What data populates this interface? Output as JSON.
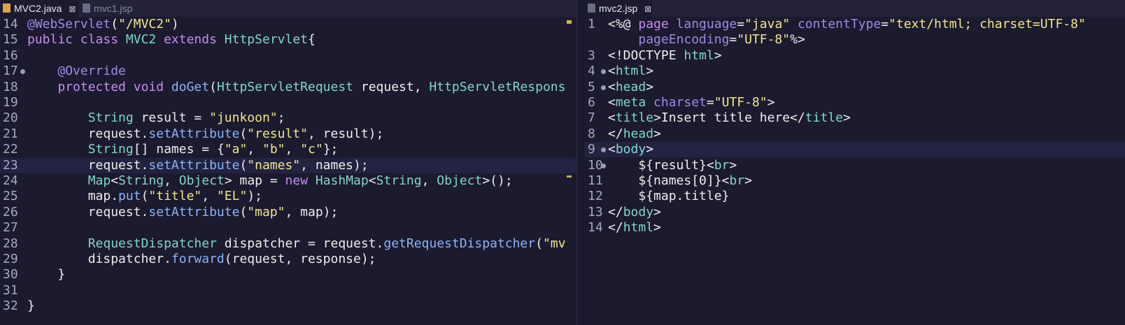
{
  "left_editor": {
    "tabs": [
      {
        "label": "MVC2.java",
        "active": true,
        "close": "⊠"
      },
      {
        "label": "mvc1.jsp",
        "active": false
      }
    ],
    "lines": [
      {
        "n": "14",
        "segs": [
          [
            "a",
            "@WebServlet"
          ],
          [
            "m",
            "("
          ],
          [
            "s",
            "\"/MVC2\""
          ],
          [
            "m",
            ")"
          ]
        ]
      },
      {
        "n": "15",
        "segs": [
          [
            "k",
            "public class "
          ],
          [
            "t",
            "MVC2"
          ],
          [
            "k",
            " extends "
          ],
          [
            "t",
            "HttpServlet"
          ],
          [
            "m",
            "{"
          ]
        ]
      },
      {
        "n": "16",
        "segs": []
      },
      {
        "n": "17",
        "segs": [
          [
            "m",
            "    "
          ],
          [
            "a",
            "@Override"
          ]
        ],
        "marker": true
      },
      {
        "n": "18",
        "segs": [
          [
            "m",
            "    "
          ],
          [
            "k",
            "protected void "
          ],
          [
            "f",
            "doGet"
          ],
          [
            "m",
            "("
          ],
          [
            "t",
            "HttpServletRequest"
          ],
          [
            "m",
            " request, "
          ],
          [
            "t",
            "HttpServletRespons"
          ]
        ]
      },
      {
        "n": "19",
        "segs": []
      },
      {
        "n": "20",
        "segs": [
          [
            "m",
            "        "
          ],
          [
            "t",
            "String"
          ],
          [
            "m",
            " result = "
          ],
          [
            "s",
            "\"junkoon\""
          ],
          [
            "m",
            ";"
          ]
        ]
      },
      {
        "n": "21",
        "segs": [
          [
            "m",
            "        request."
          ],
          [
            "f",
            "setAttribute"
          ],
          [
            "m",
            "("
          ],
          [
            "s",
            "\"result\""
          ],
          [
            "m",
            ", result);"
          ]
        ]
      },
      {
        "n": "22",
        "segs": [
          [
            "m",
            "        "
          ],
          [
            "t",
            "String"
          ],
          [
            "m",
            "[] names = {"
          ],
          [
            "s",
            "\"a\""
          ],
          [
            "m",
            ", "
          ],
          [
            "s",
            "\"b\""
          ],
          [
            "m",
            ", "
          ],
          [
            "s",
            "\"c\""
          ],
          [
            "m",
            "};"
          ]
        ]
      },
      {
        "n": "23",
        "segs": [
          [
            "m",
            "        request."
          ],
          [
            "f",
            "setAttribute"
          ],
          [
            "m",
            "("
          ],
          [
            "s",
            "\"names\""
          ],
          [
            "m",
            ", names);"
          ]
        ],
        "current": true
      },
      {
        "n": "24",
        "segs": [
          [
            "m",
            "        "
          ],
          [
            "t",
            "Map"
          ],
          [
            "m",
            "<"
          ],
          [
            "t",
            "String"
          ],
          [
            "m",
            ", "
          ],
          [
            "t",
            "Object"
          ],
          [
            "m",
            "> map = "
          ],
          [
            "k",
            "new "
          ],
          [
            "t",
            "HashMap"
          ],
          [
            "m",
            "<"
          ],
          [
            "t",
            "String"
          ],
          [
            "m",
            ", "
          ],
          [
            "t",
            "Object"
          ],
          [
            "m",
            ">();"
          ]
        ]
      },
      {
        "n": "25",
        "segs": [
          [
            "m",
            "        map."
          ],
          [
            "f",
            "put"
          ],
          [
            "m",
            "("
          ],
          [
            "s",
            "\"title\""
          ],
          [
            "m",
            ", "
          ],
          [
            "s",
            "\"EL\""
          ],
          [
            "m",
            ");"
          ]
        ]
      },
      {
        "n": "26",
        "segs": [
          [
            "m",
            "        request."
          ],
          [
            "f",
            "setAttribute"
          ],
          [
            "m",
            "("
          ],
          [
            "s",
            "\"map\""
          ],
          [
            "m",
            ", map);"
          ]
        ]
      },
      {
        "n": "27",
        "segs": []
      },
      {
        "n": "28",
        "segs": [
          [
            "m",
            "        "
          ],
          [
            "t",
            "RequestDispatcher"
          ],
          [
            "m",
            " dispatcher = request."
          ],
          [
            "f",
            "getRequestDispatcher"
          ],
          [
            "m",
            "("
          ],
          [
            "s",
            "\"mv"
          ]
        ]
      },
      {
        "n": "29",
        "segs": [
          [
            "m",
            "        dispatcher."
          ],
          [
            "f",
            "forward"
          ],
          [
            "m",
            "(request, response);"
          ]
        ]
      },
      {
        "n": "30",
        "segs": [
          [
            "m",
            "    }"
          ]
        ]
      },
      {
        "n": "31",
        "segs": []
      },
      {
        "n": "32",
        "segs": [
          [
            "m",
            "}"
          ]
        ]
      }
    ]
  },
  "right_editor": {
    "tabs": [
      {
        "label": "mvc2.jsp",
        "active": true,
        "close": "⊠"
      }
    ],
    "lines": [
      {
        "n": "1",
        "segs": [
          [
            "m",
            "<%@ "
          ],
          [
            "k",
            "page "
          ],
          [
            "attr",
            "language"
          ],
          [
            "m",
            "="
          ],
          [
            "s",
            "\"java\""
          ],
          [
            "m",
            " "
          ],
          [
            "attr",
            "contentType"
          ],
          [
            "m",
            "="
          ],
          [
            "s",
            "\"text/html; charset=UTF-8\""
          ]
        ]
      },
      {
        "n": "",
        "segs": [
          [
            "m",
            "    "
          ],
          [
            "attr",
            "pageEncoding"
          ],
          [
            "m",
            "="
          ],
          [
            "s",
            "\"UTF-8\""
          ],
          [
            "m",
            "%>"
          ]
        ]
      },
      {
        "n": "3",
        "segs": [
          [
            "m",
            "<!DOCTYPE "
          ],
          [
            "tag",
            "html"
          ],
          [
            "m",
            ">"
          ]
        ]
      },
      {
        "n": "4",
        "segs": [
          [
            "m",
            "<"
          ],
          [
            "tag",
            "html"
          ],
          [
            "m",
            ">"
          ]
        ],
        "marker": true
      },
      {
        "n": "5",
        "segs": [
          [
            "m",
            "<"
          ],
          [
            "tag",
            "head"
          ],
          [
            "m",
            ">"
          ]
        ],
        "marker": true
      },
      {
        "n": "6",
        "segs": [
          [
            "m",
            "<"
          ],
          [
            "tag",
            "meta "
          ],
          [
            "attr",
            "charset"
          ],
          [
            "m",
            "="
          ],
          [
            "s",
            "\"UTF-8\""
          ],
          [
            "m",
            ">"
          ]
        ]
      },
      {
        "n": "7",
        "segs": [
          [
            "m",
            "<"
          ],
          [
            "tag",
            "title"
          ],
          [
            "m",
            ">Insert title here</"
          ],
          [
            "tag",
            "title"
          ],
          [
            "m",
            ">"
          ]
        ]
      },
      {
        "n": "8",
        "segs": [
          [
            "m",
            "</"
          ],
          [
            "tag",
            "head"
          ],
          [
            "m",
            ">"
          ]
        ]
      },
      {
        "n": "9",
        "segs": [
          [
            "m",
            "<"
          ],
          [
            "tag",
            "body"
          ],
          [
            "m",
            ">"
          ]
        ],
        "marker": true,
        "current": true
      },
      {
        "n": "10",
        "segs": [
          [
            "m",
            "    ${result}<"
          ],
          [
            "tag",
            "br"
          ],
          [
            "m",
            ">"
          ]
        ],
        "marker": true
      },
      {
        "n": "11",
        "segs": [
          [
            "m",
            "    ${names[0]}<"
          ],
          [
            "tag",
            "br"
          ],
          [
            "m",
            ">"
          ]
        ]
      },
      {
        "n": "12",
        "segs": [
          [
            "m",
            "    ${map.title}"
          ]
        ]
      },
      {
        "n": "13",
        "segs": [
          [
            "m",
            "</"
          ],
          [
            "tag",
            "body"
          ],
          [
            "m",
            ">"
          ]
        ]
      },
      {
        "n": "14",
        "segs": [
          [
            "m",
            "</"
          ],
          [
            "tag",
            "html"
          ],
          [
            "m",
            ">"
          ]
        ]
      }
    ]
  },
  "colors": {
    "background": "#1b1a2e",
    "keyword": "#c78cf0",
    "type": "#7fd8c9",
    "string": "#f0e68c"
  }
}
